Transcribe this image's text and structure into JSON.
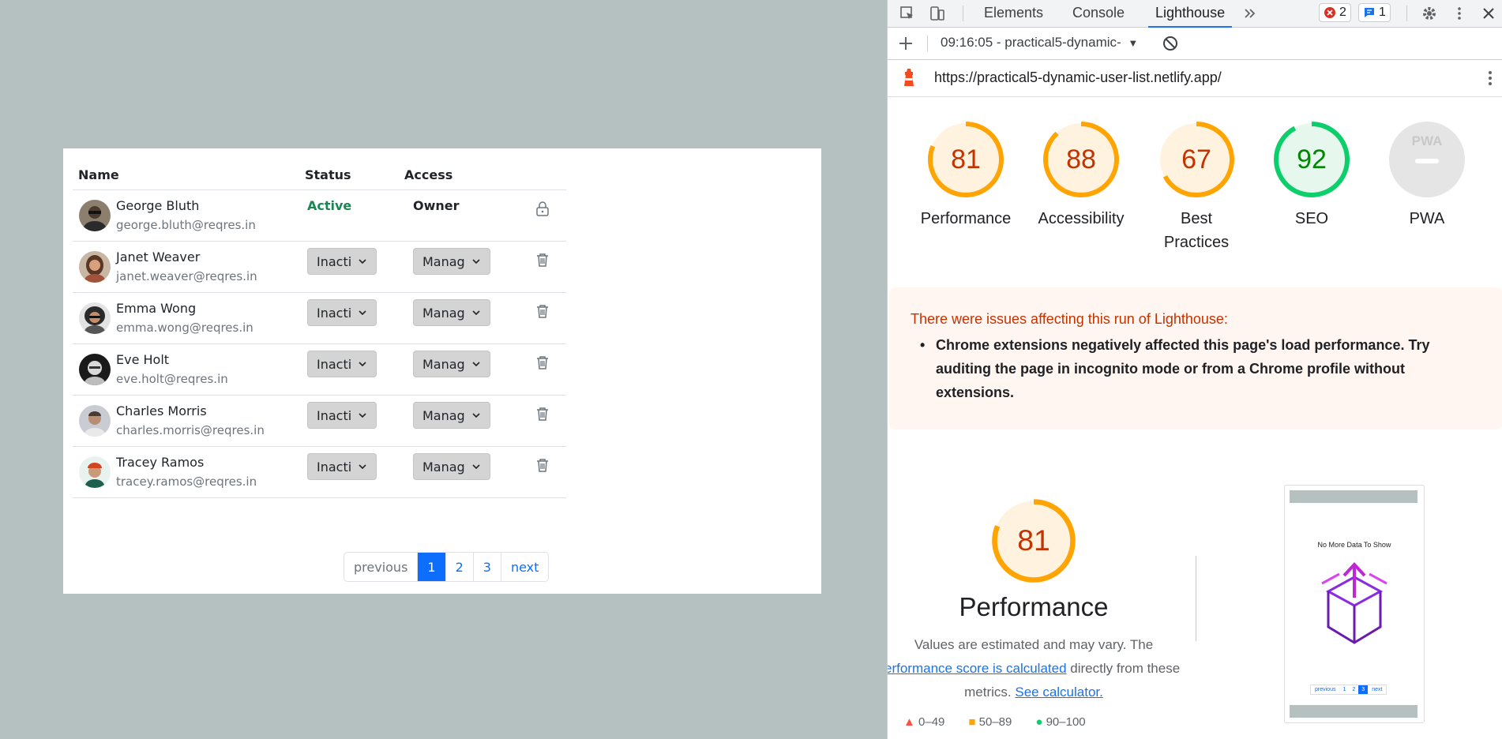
{
  "table": {
    "headers": {
      "name": "Name",
      "status": "Status",
      "access": "Access"
    },
    "rows": [
      {
        "name": "George Bluth",
        "email": "george.bluth@reqres.in",
        "status": "Active",
        "access": "Owner",
        "action_icon": "lock-icon"
      },
      {
        "name": "Janet Weaver",
        "email": "janet.weaver@reqres.in",
        "status": "Inacti",
        "access": "Manag",
        "action_icon": "trash-icon"
      },
      {
        "name": "Emma Wong",
        "email": "emma.wong@reqres.in",
        "status": "Inacti",
        "access": "Manag",
        "action_icon": "trash-icon"
      },
      {
        "name": "Eve Holt",
        "email": "eve.holt@reqres.in",
        "status": "Inacti",
        "access": "Manag",
        "action_icon": "trash-icon"
      },
      {
        "name": "Charles Morris",
        "email": "charles.morris@reqres.in",
        "status": "Inacti",
        "access": "Manag",
        "action_icon": "trash-icon"
      },
      {
        "name": "Tracey Ramos",
        "email": "tracey.ramos@reqres.in",
        "status": "Inacti",
        "access": "Manag",
        "action_icon": "trash-icon"
      }
    ]
  },
  "pagination": {
    "previous": "previous",
    "pages": [
      "1",
      "2",
      "3"
    ],
    "active": "1",
    "next": "next"
  },
  "devtools": {
    "tabs": [
      "Elements",
      "Console",
      "Lighthouse"
    ],
    "active_tab": "Lighthouse",
    "errors_count": "2",
    "messages_count": "1",
    "report_selector": "09:16:05 - practical5-dynamic-",
    "url": "https://practical5-dynamic-user-list.netlify.app/",
    "scores": [
      {
        "label": "Performance",
        "score": "81",
        "level": "average"
      },
      {
        "label": "Accessibility",
        "score": "88",
        "level": "average"
      },
      {
        "label": "Best Practices",
        "score": "67",
        "level": "average"
      },
      {
        "label": "SEO",
        "score": "92",
        "level": "pass"
      },
      {
        "label": "PWA",
        "score": "",
        "level": "na"
      }
    ],
    "warning_title": "There were issues affecting this run of Lighthouse:",
    "warning_item": "Chrome extensions negatively affected this page's load performance. Try auditing the page in incognito mode or from a Chrome profile without extensions.",
    "performance": {
      "score": "81",
      "title": "Performance",
      "desc_start": "Values are estimated and may vary. The",
      "link1": "erformance score is calculated",
      "desc_mid": "directly from these",
      "desc_mid2": "metrics.",
      "link2": "See calculator.",
      "legend": [
        "0–49",
        "50–89",
        "90–100"
      ]
    },
    "thumbnail": {
      "text": "No More Data To Show",
      "pager": [
        "previous",
        "1",
        "2",
        "3",
        "next"
      ]
    }
  },
  "colors": {
    "average": "#ffa400",
    "average_text": "#c33300",
    "pass": "#0cce6b",
    "pass_text": "#008800",
    "primary": "#0d6efd",
    "active_status": "#198754"
  }
}
